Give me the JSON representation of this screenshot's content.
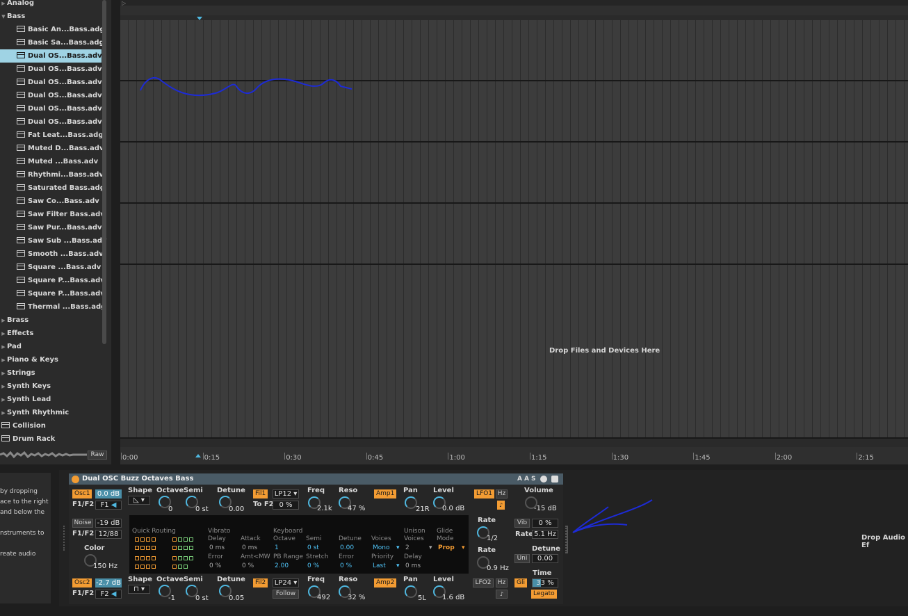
{
  "browser": {
    "items": [
      {
        "label": "Analog",
        "kind": "folder"
      },
      {
        "label": "Bass",
        "kind": "folder-open"
      },
      {
        "label": "Basic An...Bass.adg",
        "kind": "file"
      },
      {
        "label": "Basic Sa...Bass.adg",
        "kind": "file"
      },
      {
        "label": "Dual OS...Bass.adv",
        "kind": "file",
        "selected": true
      },
      {
        "label": "Dual OS...Bass.adv",
        "kind": "file"
      },
      {
        "label": "Dual OS...Bass.adv",
        "kind": "file"
      },
      {
        "label": "Dual OS...Bass.adv",
        "kind": "file"
      },
      {
        "label": "Dual OS...Bass.adv",
        "kind": "file"
      },
      {
        "label": "Dual OS...Bass.adv",
        "kind": "file"
      },
      {
        "label": "Fat Leat...Bass.adg",
        "kind": "file"
      },
      {
        "label": "Muted D...Bass.adv",
        "kind": "file"
      },
      {
        "label": "Muted ...Bass.adv",
        "kind": "file"
      },
      {
        "label": "Rhythmi...Bass.adv",
        "kind": "file"
      },
      {
        "label": "Saturated Bass.adg",
        "kind": "file"
      },
      {
        "label": "Saw Co...Bass.adv",
        "kind": "file"
      },
      {
        "label": "Saw Filter Bass.adv",
        "kind": "file"
      },
      {
        "label": "Saw Pur...Bass.adv",
        "kind": "file"
      },
      {
        "label": "Saw Sub ...Bass.adv",
        "kind": "file"
      },
      {
        "label": "Smooth ...Bass.adv",
        "kind": "file"
      },
      {
        "label": "Square ...Bass.adv",
        "kind": "file"
      },
      {
        "label": "Square P...Bass.adv",
        "kind": "file"
      },
      {
        "label": "Square P...Bass.adv",
        "kind": "file"
      },
      {
        "label": "Thermal ...Bass.adg",
        "kind": "file"
      },
      {
        "label": "Brass",
        "kind": "folder"
      },
      {
        "label": "Effects",
        "kind": "folder"
      },
      {
        "label": "Pad",
        "kind": "folder"
      },
      {
        "label": "Piano & Keys",
        "kind": "folder"
      },
      {
        "label": "Strings",
        "kind": "folder"
      },
      {
        "label": "Synth Keys",
        "kind": "folder"
      },
      {
        "label": "Synth Lead",
        "kind": "folder"
      },
      {
        "label": "Synth Rhythmic",
        "kind": "folder"
      },
      {
        "label": "Collision",
        "kind": "device"
      },
      {
        "label": "Drum Rack",
        "kind": "device"
      }
    ],
    "raw_label": "Raw"
  },
  "arrangement": {
    "drop_text": "Drop Files and Devices Here",
    "timeline": [
      "0:00",
      "0:15",
      "0:30",
      "0:45",
      "1:00",
      "1:15",
      "1:30",
      "1:45",
      "2:00",
      "2:15"
    ]
  },
  "info_panel": {
    "text": "by dropping\nace to the right\nand below the\n\nnstruments to\n\nreate audio"
  },
  "device": {
    "title": "Dual OSC Buzz Octaves Bass",
    "header_buttons": [
      "A",
      "A",
      "S"
    ],
    "osc1": {
      "label": "Osc1",
      "level": "0.0 dB",
      "f1f2_label": "F1/F2",
      "f1f2": "F1",
      "shape_label": "Shape",
      "octave_label": "Octave",
      "octave": "0",
      "semi_label": "Semi",
      "semi": "0 st",
      "detune_label": "Detune",
      "detune": "0.00"
    },
    "osc2": {
      "label": "Osc2",
      "level": "-2.7 dB",
      "f1f2_label": "F1/F2",
      "f1f2": "F2",
      "shape_label": "Shape",
      "octave_label": "Octave",
      "octave": "-1",
      "semi_label": "Semi",
      "semi": "0 st",
      "detune_label": "Detune",
      "detune": "0.05"
    },
    "noise": {
      "label": "Noise",
      "level": "-19 dB",
      "f1f2_label": "F1/F2",
      "f1f2": "12/88",
      "color_label": "Color",
      "color": "150 Hz"
    },
    "fil1": {
      "label": "Fil1",
      "type": "LP12",
      "to_f2_label": "To F2",
      "to_f2": "0 %",
      "freq_label": "Freq",
      "freq": "2.1k",
      "reso_label": "Reso",
      "reso": "47 %"
    },
    "fil2": {
      "label": "Fil2",
      "type": "LP24",
      "follow": "Follow",
      "freq_label": "Freq",
      "freq": "492",
      "reso_label": "Reso",
      "reso": "32 %"
    },
    "amp1": {
      "label": "Amp1",
      "pan_label": "Pan",
      "pan": "21R",
      "level_label": "Level",
      "level": "0.0 dB"
    },
    "amp2": {
      "label": "Amp2",
      "pan_label": "Pan",
      "pan": "5L",
      "level_label": "Level",
      "level": "1.6 dB"
    },
    "lfo1": {
      "label": "LFO1",
      "hz": "Hz",
      "rate_label": "Rate",
      "rate": "1/2"
    },
    "lfo2": {
      "label": "LFO2",
      "hz": "Hz",
      "rate_label": "Rate",
      "rate": "0.9 Hz"
    },
    "global": {
      "volume_label": "Volume",
      "volume": "-15 dB",
      "vib": "Vib",
      "vib_val": "0 %",
      "rate_label": "Rate",
      "rate": "5.1 Hz",
      "uni": "Uni",
      "detune_label": "Detune",
      "detune": "0.00",
      "gli": "Gli",
      "time_label": "Time",
      "time": "33 %",
      "legato": "Legato"
    },
    "routing": {
      "quick_routing": "Quick Routing",
      "vibrato": "Vibrato",
      "delay": "Delay",
      "delay_val": "0 ms",
      "attack": "Attack",
      "attack_val": "0 ms",
      "error": "Error",
      "error_val": "0 %",
      "amt_mw": "Amt<MW",
      "amt_mw_val": "0 %",
      "keyboard": "Keyboard",
      "octave": "Octave",
      "octave_val": "1",
      "semi": "Semi",
      "semi_val": "0 st",
      "detune": "Detune",
      "detune_val": "0.00",
      "pb_range": "PB Range",
      "pb_range_val": "2.00",
      "stretch": "Stretch",
      "stretch_val": "0 %",
      "error2": "Error",
      "error2_val": "0 %",
      "voices": "Voices",
      "voices_val": "Mono",
      "priority": "Priority",
      "priority_val": "Last",
      "unison": "Unison",
      "unison_voices": "Voices",
      "unison_voices_val": "2",
      "unison_delay": "Delay",
      "unison_delay_val": "0 ms",
      "glide": "Glide",
      "glide_mode": "Mode",
      "glide_mode_val": "Prop"
    }
  },
  "right_drop": "Drop Audio Ef"
}
